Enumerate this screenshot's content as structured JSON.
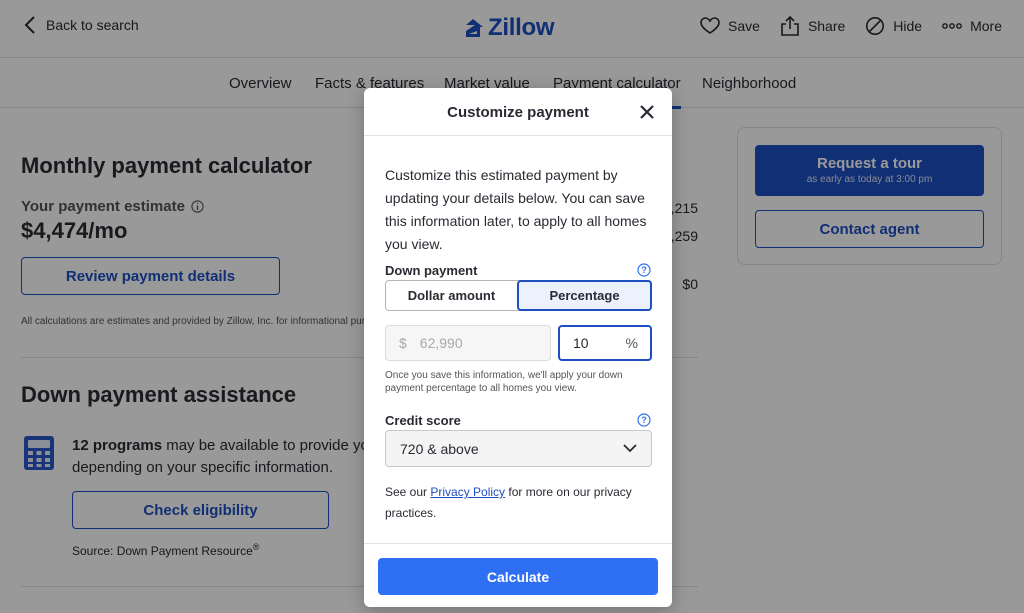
{
  "header": {
    "back_label": "Back to search",
    "logo_text": "Zillow",
    "actions": {
      "save": "Save",
      "share": "Share",
      "hide": "Hide",
      "more": "More"
    }
  },
  "tabs": [
    "Overview",
    "Facts & features",
    "Market value",
    "Payment calculator",
    "Neighborhood"
  ],
  "active_tab": "Payment calculator",
  "calculator": {
    "title": "Monthly payment calculator",
    "estimate_label": "Your payment estimate",
    "estimate_value": "$4,474/mo",
    "review_button": "Review payment details",
    "disclaimer": "All calculations are estimates and provided by Zillow, Inc. for informational purposes only.",
    "side_values": [
      ",215",
      ",259",
      "$0"
    ]
  },
  "assistance": {
    "title": "Down payment assistance",
    "programs_bold": "12 programs",
    "programs_rest": " may be available to provide you",
    "programs_line2": "depending on your specific information.",
    "check_button": "Check eligibility",
    "source": "Source: Down Payment Resource",
    "source_mark": "®"
  },
  "tour_card": {
    "request_label": "Request a tour",
    "request_sub": "as early as today at 3:00 pm",
    "contact_label": "Contact agent"
  },
  "modal": {
    "title": "Customize payment",
    "intro": "Customize this estimated payment by updating your details below. You can save this information later, to apply to all homes you view.",
    "down_payment_label": "Down payment",
    "toggle": {
      "dollar": "Dollar amount",
      "percentage": "Percentage",
      "selected": "Percentage"
    },
    "amount_prefix": "$",
    "amount_value": "62,990",
    "percent_value": "10",
    "percent_suffix": "%",
    "note": "Once you save this information, we'll apply your down payment percentage to all homes you view.",
    "credit_label": "Credit score",
    "credit_value": "720 & above",
    "privacy_before": "See our ",
    "privacy_link": "Privacy Policy",
    "privacy_after": " for more on our privacy practices.",
    "calculate_button": "Calculate"
  },
  "colors": {
    "brand_blue": "#1d4fc2",
    "button_blue": "#2f6ff4",
    "overlay": "rgba(0,0,0,0.4)"
  },
  "icons": [
    "chevron-left-icon",
    "zillow-logo-icon",
    "heart-icon",
    "share-icon",
    "hide-icon",
    "more-icon",
    "info-icon",
    "calculator-icon",
    "close-icon",
    "help-icon",
    "chevron-down-icon"
  ]
}
